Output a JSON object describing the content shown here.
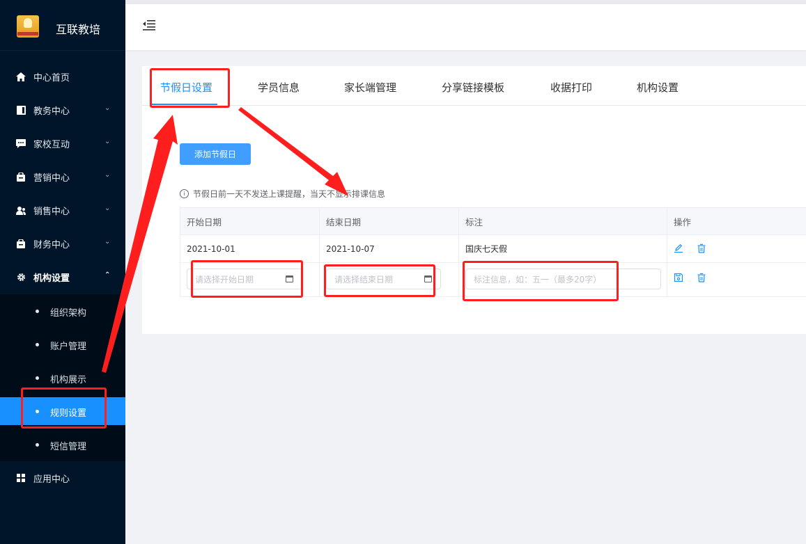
{
  "app": {
    "name": "互联教培"
  },
  "sidebar": {
    "items": [
      {
        "label": "中心首页",
        "icon": "home-icon",
        "has_arrow": false
      },
      {
        "label": "教务中心",
        "icon": "book-icon",
        "has_arrow": true
      },
      {
        "label": "家校互动",
        "icon": "chat-icon",
        "has_arrow": true
      },
      {
        "label": "营销中心",
        "icon": "bag-icon",
        "has_arrow": true
      },
      {
        "label": "销售中心",
        "icon": "people-icon",
        "has_arrow": true
      },
      {
        "label": "财务中心",
        "icon": "wallet-icon",
        "has_arrow": true
      },
      {
        "label": "机构设置",
        "icon": "gear-icon",
        "has_arrow": true,
        "expanded": true
      },
      {
        "label": "应用中心",
        "icon": "grid-icon",
        "has_arrow": false
      }
    ],
    "sub_items": [
      "组织架构",
      "账户管理",
      "机构展示",
      "规则设置",
      "短信管理"
    ],
    "active_sub": "规则设置"
  },
  "tabs": [
    "节假日设置",
    "学员信息",
    "家长端管理",
    "分享链接模板",
    "收据打印",
    "机构设置"
  ],
  "active_tab": "节假日设置",
  "add_button": "添加节假日",
  "tip": "节假日前一天不发送上课提醒，当天不显示排课信息",
  "table": {
    "headers": [
      "开始日期",
      "结束日期",
      "标注",
      "操作"
    ],
    "rows": [
      {
        "start": "2021-10-01",
        "end": "2021-10-07",
        "note": "国庆七天假"
      }
    ],
    "new_row": {
      "start_placeholder": "请选择开始日期",
      "end_placeholder": "请选择结束日期",
      "note_placeholder": "标注信息，如：五一（最多20字）"
    }
  },
  "colors": {
    "accent": "#1890ff",
    "sidebar_bg": "#001529",
    "annotation": "#ff1e1e"
  }
}
